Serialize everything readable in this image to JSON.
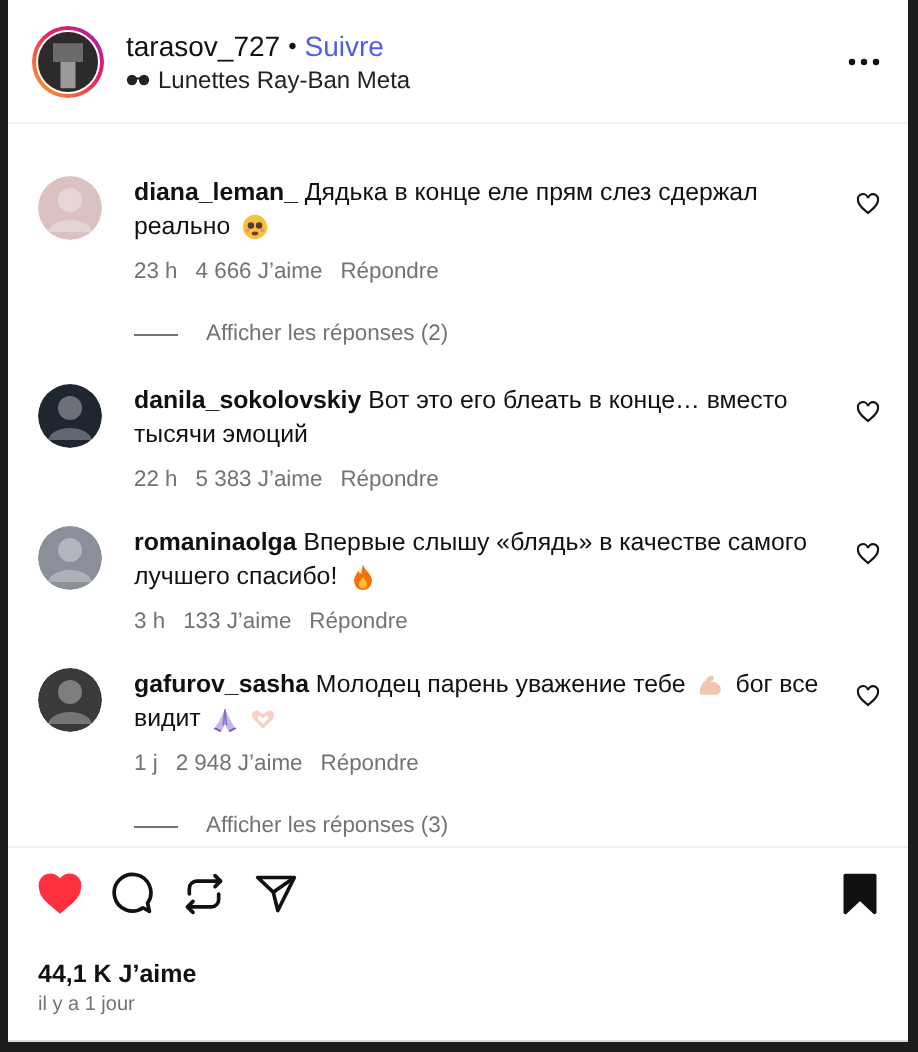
{
  "header": {
    "username": "tarasov_727",
    "separator": "•",
    "follow": "Suivre",
    "subtitle": "Lunettes Ray-Ban Meta"
  },
  "comments": [
    {
      "lines": [
        [
          {
            "kind": "text",
            "text": "**diana_leman_** Дядька в конце еле прям слез сдержал"
          }
        ],
        [
          {
            "kind": "text",
            "text": "реально"
          },
          {
            "kind": "pleading"
          }
        ]
      ],
      "time": "23 h",
      "likes": "4 666 J’aime",
      "reply": "Répondre",
      "liked": false,
      "replies_link": "Afficher les réponses (2)"
    },
    {
      "lines": [
        [
          {
            "kind": "text",
            "text": "**danila_sokolovskiy** Вот это его блеать в конце… вместо"
          }
        ],
        [
          {
            "kind": "text",
            "text": "тысячи эмоций"
          }
        ]
      ],
      "time": "22 h",
      "likes": "5 383 J’aime",
      "reply": "Répondre",
      "liked": false
    },
    {
      "lines": [
        [
          {
            "kind": "text",
            "text": "**romaninaolga** Впервые слышу «блядь» в качестве самого"
          }
        ],
        [
          {
            "kind": "text",
            "text": "лучшего спасибо!"
          },
          {
            "kind": "fire"
          }
        ]
      ],
      "time": "3 h",
      "likes": "133 J’aime",
      "reply": "Répondre",
      "liked": false
    },
    {
      "lines": [
        [
          {
            "kind": "text",
            "text": "**gafurov_sasha** Молодец парень уважение тебе"
          },
          {
            "kind": "muscle"
          },
          {
            "kind": "text",
            "text": "бог все"
          }
        ],
        [
          {
            "kind": "text",
            "text": "видит"
          },
          {
            "kind": "pray"
          },
          {
            "kind": "heart-hands"
          }
        ]
      ],
      "time": "1 j",
      "likes": "2 948 J’aime",
      "reply": "Répondre",
      "liked": false,
      "replies_link": "Afficher les réponses (3)"
    }
  ],
  "post": {
    "liked": true,
    "saved": true,
    "likes": "44,1 K J’aime",
    "date": "il y a 1 jour"
  }
}
